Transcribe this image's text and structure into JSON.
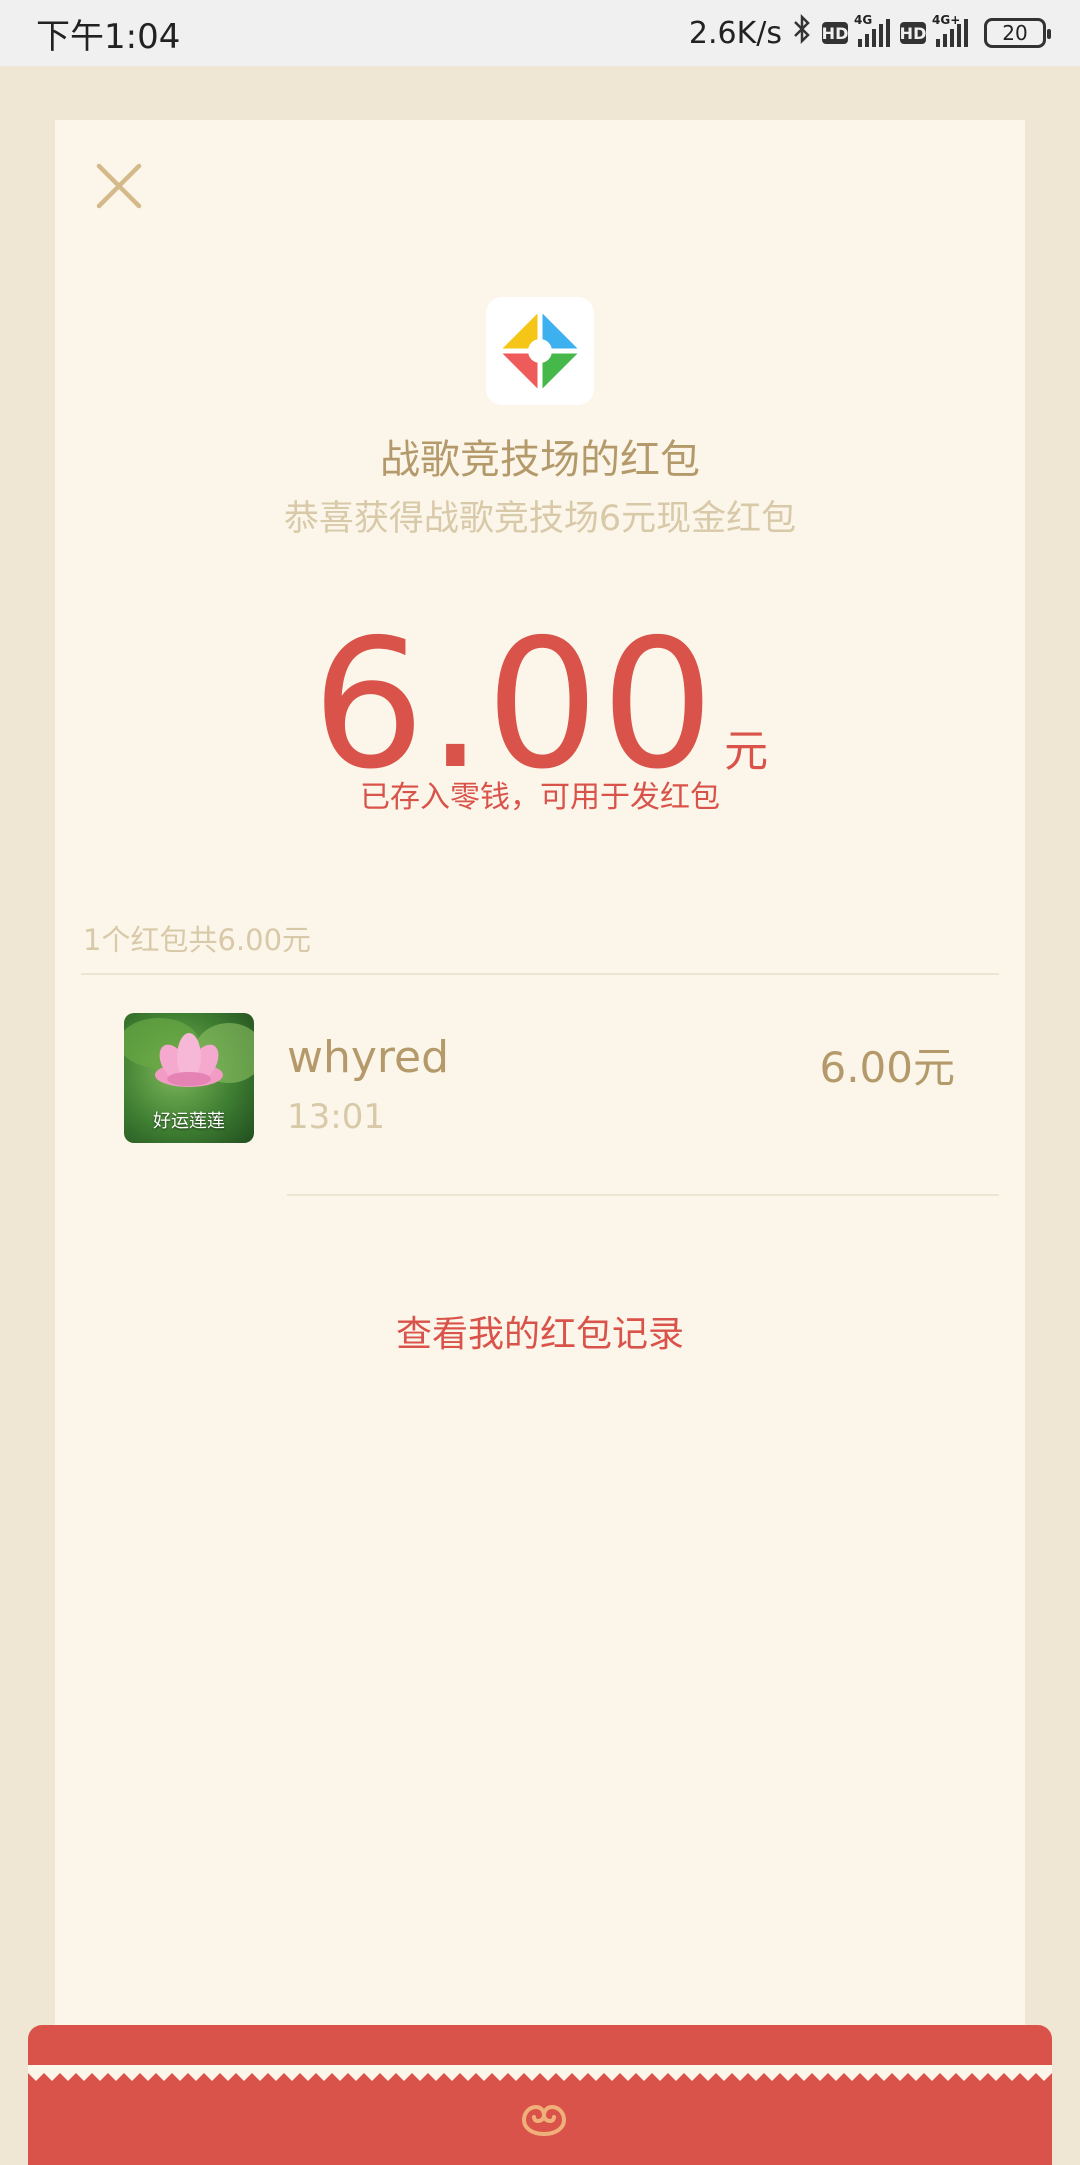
{
  "status_bar": {
    "time": "下午1:04",
    "net_speed": "2.6K/s",
    "sim1_label": "4G",
    "sim2_label": "4G+",
    "hd_label": "HD",
    "battery": "20"
  },
  "red_packet": {
    "title": "战歌竞技场的红包",
    "greeting": "恭喜获得战歌竞技场6元现金红包",
    "amount": "6.00",
    "unit": "元",
    "deposit_note": "已存入零钱，可用于发红包",
    "summary": "1个红包共6.00元"
  },
  "record": {
    "avatar_caption": "好运莲莲",
    "name": "whyred",
    "time": "13:01",
    "amount": "6.00元"
  },
  "history_link": "查看我的红包记录",
  "colors": {
    "accent_red": "#d9534a",
    "gold_text": "#b49a6a",
    "muted_text": "#d8c9a8",
    "card_bg": "#fcf6ea",
    "page_bg": "#efe6d3"
  },
  "icons": {
    "close": "close-icon",
    "app": "app-logo-icon",
    "bluetooth": "bluetooth-icon",
    "bottom": "red-packet-cloud-icon"
  }
}
